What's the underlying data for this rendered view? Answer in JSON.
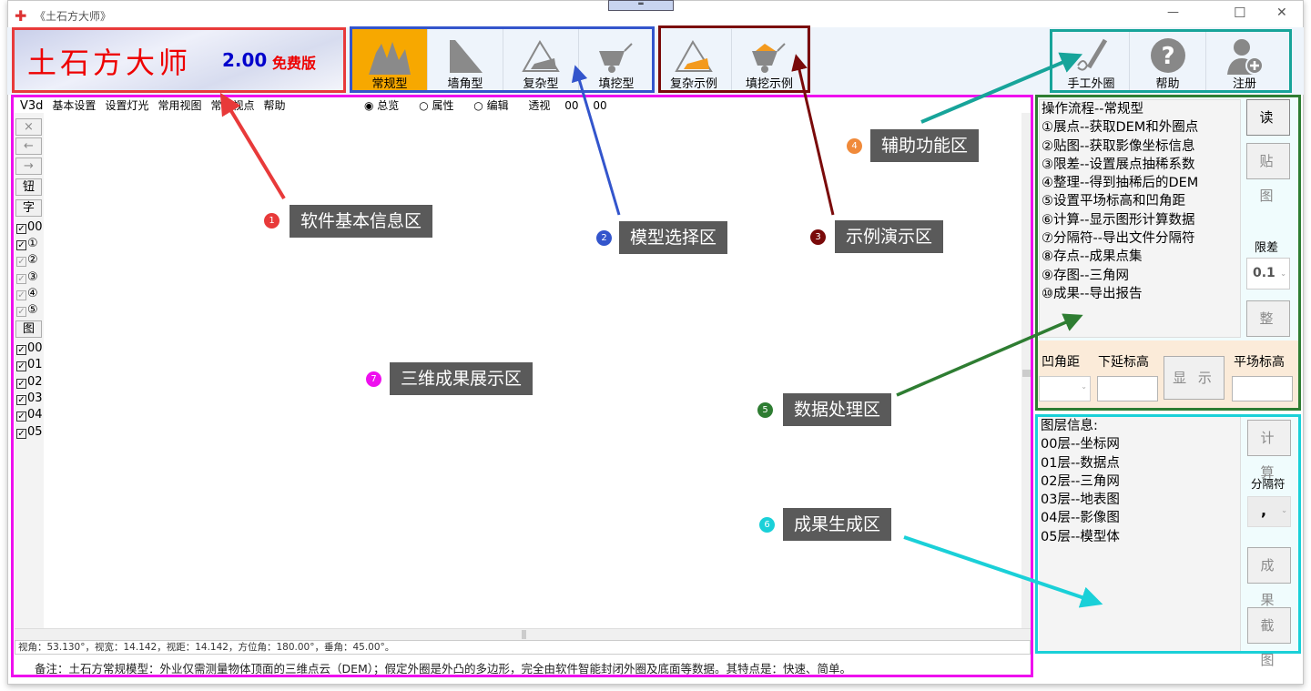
{
  "window": {
    "title": "《土石方大师》",
    "minimize": "—",
    "maximize": "☐",
    "close": "✕"
  },
  "banner": {
    "title": "土石方大师",
    "version": "2.00",
    "edition": "免费版"
  },
  "model_buttons": [
    {
      "label": "常规型",
      "active": true
    },
    {
      "label": "墙角型"
    },
    {
      "label": "复杂型"
    },
    {
      "label": "填挖型"
    }
  ],
  "example_buttons": [
    {
      "label": "复杂示例"
    },
    {
      "label": "填挖示例"
    }
  ],
  "aux_buttons": [
    {
      "label": "手工外圈"
    },
    {
      "label": "帮助"
    },
    {
      "label": "注册"
    }
  ],
  "menubar": {
    "items": [
      "V3d",
      "基本设置",
      "设置灯光",
      "常用视图",
      "常用视点",
      "帮助"
    ],
    "radios": [
      {
        "label": "总览",
        "checked": true
      },
      {
        "label": "属性",
        "checked": false
      },
      {
        "label": "编辑",
        "checked": false
      }
    ],
    "perspective": "透视",
    "v1": "00",
    "v2": "00"
  },
  "left_strip": {
    "buttons": [
      "×",
      "←",
      "→",
      "钮",
      "字"
    ],
    "checks1": [
      {
        "label": "00"
      },
      {
        "label": "①"
      },
      {
        "label": "②",
        "dim": true
      },
      {
        "label": "③",
        "dim": true
      },
      {
        "label": "④",
        "dim": true
      },
      {
        "label": "⑤",
        "dim": true
      }
    ],
    "map_button": "图",
    "checks2": [
      "00",
      "01",
      "02",
      "03",
      "04",
      "05"
    ]
  },
  "status": "视角：53.130°，视宽：14.142，视距：14.142，方位角：180.00°，垂角：45.00°。",
  "note": "备注：土石方常规模型：外业仅需测量物体顶面的三维点云（DEM）；假定外圈是外凸的多边形，完全由软件智能封闭外圈及底面等数据。其特点是：快速、简单。",
  "process": {
    "lines": [
      "操作流程--常规型",
      "①展点--获取DEM和外圈点",
      "②贴图--获取影像坐标信息",
      "③限差--设置展点抽稀系数",
      "④整理--得到抽稀后的DEM",
      "⑤设置平场标高和凹角距",
      "⑥计算--显示图形计算数据",
      "⑦分隔符--导出文件分隔符",
      "⑧存点--成果点集",
      "⑨存图--三角网",
      "⑩成果--导出报告"
    ],
    "read_btn": "读 点",
    "map_btn": "贴 图",
    "tolerance_label": "限差",
    "tolerance_value": "0.1",
    "tidy_btn": "整 理",
    "concave_label": "凹角距",
    "lower_label": "下延标高",
    "show_btn": "显 示",
    "level_label": "平场标高"
  },
  "layers": {
    "lines": [
      "图层信息:",
      "00层--坐标网",
      "01层--数据点",
      "02层--三角网",
      "03层--地表图",
      "04层--影像图",
      "05层--模型体"
    ],
    "calc_btn": "计 算",
    "sep_label": "分隔符",
    "sep_value": ",",
    "result_btn": "成 果",
    "capture_btn": "截 图"
  },
  "callouts": [
    {
      "n": "1",
      "text": "软件基本信息区",
      "color": "#e83a3a"
    },
    {
      "n": "2",
      "text": "模型选择区",
      "color": "#3355cc"
    },
    {
      "n": "3",
      "text": "示例演示区",
      "color": "#7a0a0a"
    },
    {
      "n": "4",
      "text": "辅助功能区",
      "color": "#f08a3a"
    },
    {
      "n": "5",
      "text": "数据处理区",
      "color": "#2e7d32"
    },
    {
      "n": "6",
      "text": "成果生成区",
      "color": "#1ad0d8"
    },
    {
      "n": "7",
      "text": "三维成果展示区",
      "color": "#ee10ee"
    }
  ]
}
